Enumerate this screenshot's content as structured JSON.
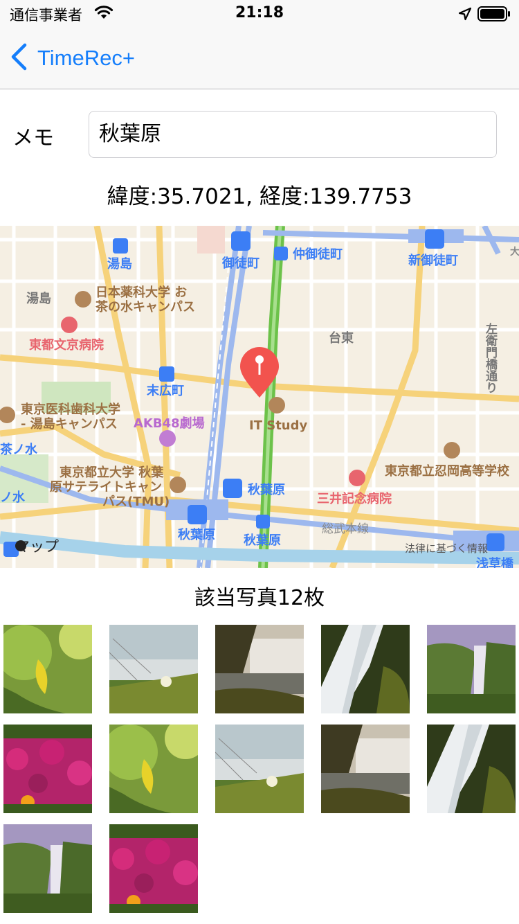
{
  "status_bar": {
    "carrier": "通信事業者",
    "time": "21:18"
  },
  "nav": {
    "back_label": "TimeRec+"
  },
  "memo": {
    "label": "メモ",
    "value": "秋葉原"
  },
  "coords_text": "緯度:35.7021, 経度:139.7753",
  "map": {
    "labels": {
      "yushima_station": "湯島",
      "yushima": "湯島",
      "okachimachi": "御徒町",
      "naka_okachimachi": "仲御徒町",
      "shin_okachimachi": "新御徒町",
      "univ_1": "日本薬科大学 お",
      "univ_2": "茶の水キャンパス",
      "hospital_1": "東都文京病院",
      "taito": "台東",
      "street": "左衛門橋通り",
      "suehirocho": "末広町",
      "dental_1": "東京医科歯科大学",
      "dental_2": "- 湯島キャンパス",
      "akb": "AKB48劇場",
      "itstudy": "IT Study",
      "ochanomizu": "御茶ノ水",
      "tmu_1": "東京都立大学 秋葉",
      "tmu_2": "原サテライトキャン",
      "tmu_3": "パス(TMU)",
      "akihabara_1": "秋葉原",
      "akihabara_2": "秋葉原",
      "akihabara_3": "秋葉原",
      "mitsui": "三井記念病院",
      "sobu": "総武本線",
      "school": "東京都立忍岡高等学校",
      "asakusabashi": "浅草橋",
      "legal": "法律に基づく情報",
      "maps_brand": "マップ",
      "edge_1": "ノ水",
      "edge_2": "茶ノ水",
      "edge_3": "大"
    }
  },
  "photos": {
    "count_text": "該当写真12枚"
  }
}
